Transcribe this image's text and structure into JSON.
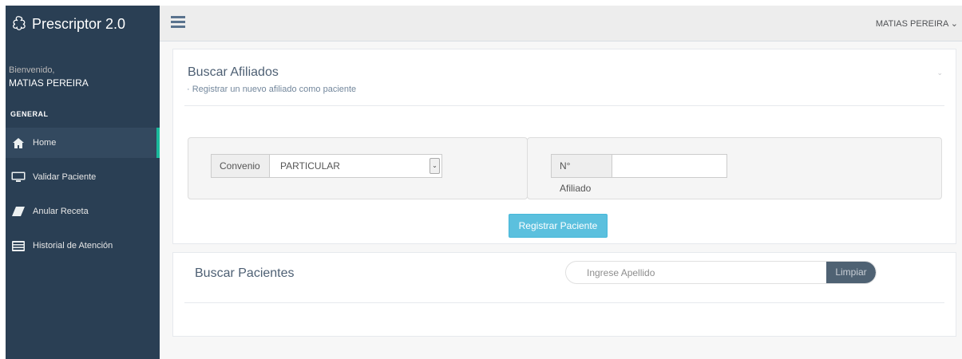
{
  "brand": {
    "title": "Prescriptor 2.0"
  },
  "profile": {
    "welcome": "Bienvenido,",
    "name": "MATIAS PEREIRA"
  },
  "menu": {
    "section": "GENERAL",
    "items": [
      {
        "label": "Home",
        "icon": "home-icon"
      },
      {
        "label": "Validar Paciente",
        "icon": "monitor-icon"
      },
      {
        "label": "Anular Receta",
        "icon": "eraser-icon"
      },
      {
        "label": "Historial de Atención",
        "icon": "list-icon"
      }
    ]
  },
  "topbar": {
    "user": "MATIAS PEREIRA"
  },
  "afiliados": {
    "title": "Buscar Afiliados",
    "subtitle": "· Registrar un nuevo afiliado como paciente",
    "convenio_label": "Convenio",
    "convenio_value": "PARTICULAR",
    "afiliado_label": "N° Afiliado",
    "afiliado_value": "",
    "register_button": "Registrar Paciente"
  },
  "pacientes": {
    "title": "Buscar Pacientes",
    "search_placeholder": "Ingrese Apellido",
    "clear_button": "Limpiar"
  },
  "colors": {
    "sidebar": "#2a3f54",
    "accent": "#1abb9c",
    "primary_button": "#5bc0de",
    "clear_button": "#4f6273"
  }
}
